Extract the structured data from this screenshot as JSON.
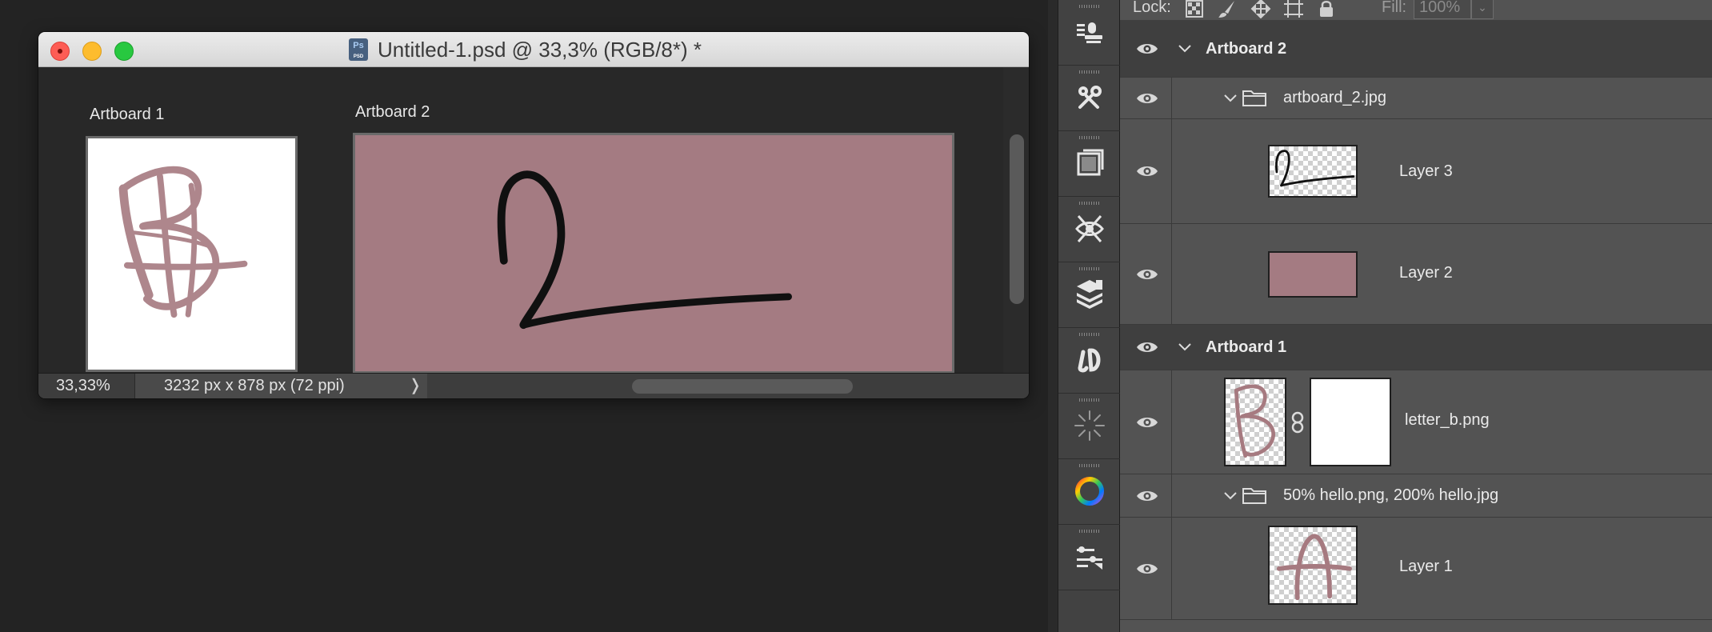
{
  "document_window": {
    "title": "Untitled-1.psd @ 33,3% (RGB/8*) *",
    "doc_icon": "ps-document-icon",
    "artboards": [
      {
        "label": "Artboard 1",
        "content": "letter-b-sketch"
      },
      {
        "label": "Artboard 2",
        "content": "number-2-sketch"
      }
    ],
    "status": {
      "zoom": "33,33%",
      "doc_info": "3232 px x 878 px (72 ppi)",
      "chevron": "❭"
    }
  },
  "colors": {
    "artboard2_fill": "#a47b82",
    "stroke_pink": "#a67a80",
    "panel_bg": "#535353",
    "artboard_row_bg": "#3f3f3f"
  },
  "dock": {
    "tools": [
      "clone-source-icon",
      "tools-presets-icon",
      "libraries-icon",
      "3d-visibility-icon",
      "mockup-stack-icon",
      "cloud-documents-icon",
      "brush-burst-icon",
      "color-wheel-icon",
      "adjustments-icon"
    ]
  },
  "layers_panel": {
    "lock_label": "Lock:",
    "lock_icons": [
      "lock-transparent-pixels-icon",
      "lock-image-pixels-icon",
      "lock-position-icon",
      "lock-artboard-icon",
      "lock-all-icon"
    ],
    "fill_label": "Fill:",
    "fill_value": "100%",
    "rows": [
      {
        "type": "artboard",
        "name": "Artboard 2",
        "expanded": true
      },
      {
        "type": "group",
        "name": "artboard_2.jpg",
        "expanded": true
      },
      {
        "type": "layer",
        "name": "Layer 3",
        "thumb": "number-2-thumb"
      },
      {
        "type": "layer",
        "name": "Layer 2",
        "thumb": "solid-pink-thumb"
      },
      {
        "type": "artboard",
        "name": "Artboard 1",
        "expanded": true
      },
      {
        "type": "layer-with-mask",
        "name": "letter_b.png",
        "thumb": "letter-b-thumb"
      },
      {
        "type": "group",
        "name": "50% hello.png, 200% hello.jpg",
        "expanded": true
      },
      {
        "type": "layer",
        "name": "Layer 1",
        "thumb": "letter-a-thumb"
      }
    ]
  }
}
